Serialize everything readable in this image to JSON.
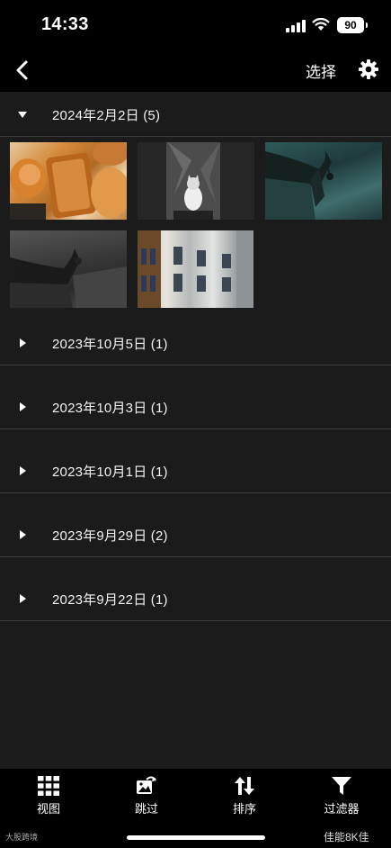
{
  "status": {
    "time": "14:33",
    "battery": "90"
  },
  "nav": {
    "select_label": "选择"
  },
  "groups": [
    {
      "label": "2024年2月2日 (5)",
      "expanded": true
    },
    {
      "label": "2023年10月5日 (1)",
      "expanded": false
    },
    {
      "label": "2023年10月3日 (1)",
      "expanded": false
    },
    {
      "label": "2023年10月1日 (1)",
      "expanded": false
    },
    {
      "label": "2023年9月29日 (2)",
      "expanded": false
    },
    {
      "label": "2023年9月22日 (1)",
      "expanded": false
    }
  ],
  "thumbnails": [
    {
      "icon": "photo-bread"
    },
    {
      "icon": "photo-cat"
    },
    {
      "icon": "photo-eave-bell"
    },
    {
      "icon": "photo-eave-roof"
    },
    {
      "icon": "photo-building"
    }
  ],
  "tabs": [
    {
      "label": "视图",
      "icon": "grid-icon"
    },
    {
      "label": "跳过",
      "icon": "skip-icon"
    },
    {
      "label": "排序",
      "icon": "sort-icon"
    },
    {
      "label": "过滤器",
      "icon": "filter-icon"
    }
  ],
  "watermark": {
    "left": "大股跨境",
    "right": "佳能8K佳"
  }
}
